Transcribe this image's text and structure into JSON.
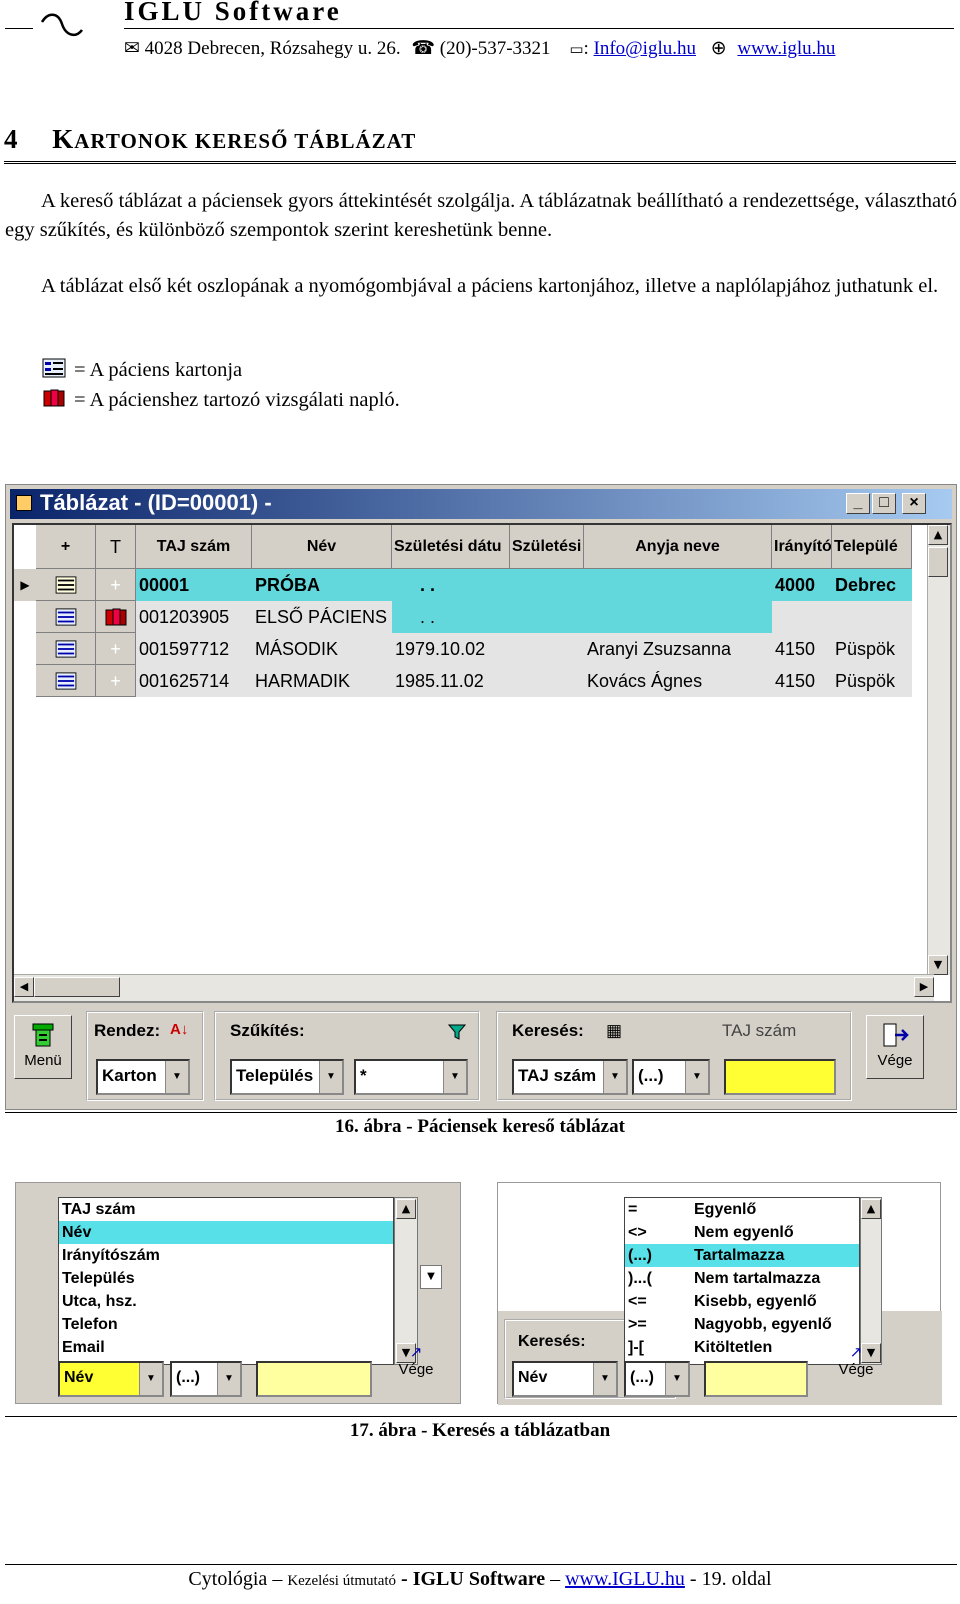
{
  "header": {
    "company": "IGLU Software",
    "address": "4028 Debrecen, Rózsahegy u. 26.",
    "phone": "(20)-537-3321",
    "email_label": ":",
    "email": "Info@iglu.hu",
    "web": "www.iglu.hu"
  },
  "chapter": {
    "number": "4",
    "first": "K",
    "rest": "ARTONOK KERESŐ TÁBLÁZAT"
  },
  "paragraphs": [
    "A kereső táblázat a páciensek gyors áttekintését szolgálja. A táblázatnak beállítható a rendezettsége, választható egy szűkítés, és különböző szempontok szerint kereshetünk benne.",
    "A táblázat első két oszlopának a nyomógombjával a páciens kartonjához, illetve a naplólapjához juthatunk el."
  ],
  "legend": [
    {
      "icon": "card-icon",
      "text": "= A páciens kartonja"
    },
    {
      "icon": "book-icon",
      "text": "= A pácienshez tartozó vizsgálati napló."
    }
  ],
  "window": {
    "title": "Táblázat - (ID=00001) -",
    "columns": [
      "+",
      "T",
      "TAJ szám",
      "Név",
      "Születési dátu",
      "Születési",
      "Anyja neve",
      "Irányító",
      "Települé"
    ],
    "rows": [
      {
        "taj": "00001",
        "name": "PRÓBA",
        "birth": ". .",
        "mother": "",
        "zip": "4000",
        "city": "Debrec",
        "journal": "+"
      },
      {
        "taj": "001203905",
        "name": "ELSŐ PÁCIENS",
        "birth": ". .",
        "mother": "",
        "zip": "",
        "city": "",
        "journal": "book"
      },
      {
        "taj": "001597712",
        "name": "MÁSODIK",
        "birth": "1979.10.02",
        "mother": "Aranyi Zsuzsanna",
        "zip": "4150",
        "city": "Püspök",
        "journal": "+"
      },
      {
        "taj": "001625714",
        "name": "HARMADIK",
        "birth": "1985.11.02",
        "mother": "Kovács Ágnes",
        "zip": "4150",
        "city": "Püspök",
        "journal": "+"
      }
    ],
    "menu_label": "Menü",
    "sort_label": "Rendez:",
    "sort_value": "Karton",
    "filter_label": "Szűkítés:",
    "filter_field": "Település",
    "filter_value": "*",
    "search_label": "Keresés:",
    "search_field": "TAJ szám",
    "search_op": "(...)",
    "search_hint": "TAJ szám",
    "exit_label": "Vége"
  },
  "caption16": "16. ábra - Páciensek kereső táblázat",
  "shot_left": {
    "items": [
      "TAJ szám",
      "Név",
      "Irányítószám",
      "Település",
      "Utca, hsz.",
      "Telefon",
      "Email"
    ],
    "selected": 1,
    "field": "Név",
    "op": "(...)",
    "exit_label": "Vége"
  },
  "shot_right": {
    "items": [
      {
        "op": "=",
        "label": "Egyenlő"
      },
      {
        "op": "<>",
        "label": "Nem egyenlő"
      },
      {
        "op": "(...)",
        "label": "Tartalmazza"
      },
      {
        "op": ")...(",
        "label": "Nem tartalmazza"
      },
      {
        "op": "<=",
        "label": "Kisebb, egyenlő"
      },
      {
        "op": ">=",
        "label": "Nagyobb, egyenlő"
      },
      {
        "op": "]-[",
        "label": "Kitöltetlen"
      }
    ],
    "selected": 2,
    "search_label": "Keresés:",
    "field": "Név",
    "op": "(...)",
    "exit_label": "Vége"
  },
  "caption17": "17. ábra - Keresés a táblázatban",
  "footer": {
    "title": "Cytológia",
    "dash1": "–",
    "subtitle": "Kezelési útmutató",
    "sep": "-",
    "company": "IGLU Software",
    "dash2": "–",
    "url": "www.IGLU.hu",
    "page": "- 19. oldal"
  },
  "colors": {
    "row_highlight": "#62d8dc",
    "row_grey": "#e4e4e4",
    "link": "#0000cc",
    "title_bar": "#0a246a",
    "search_box": "#ffff33"
  }
}
